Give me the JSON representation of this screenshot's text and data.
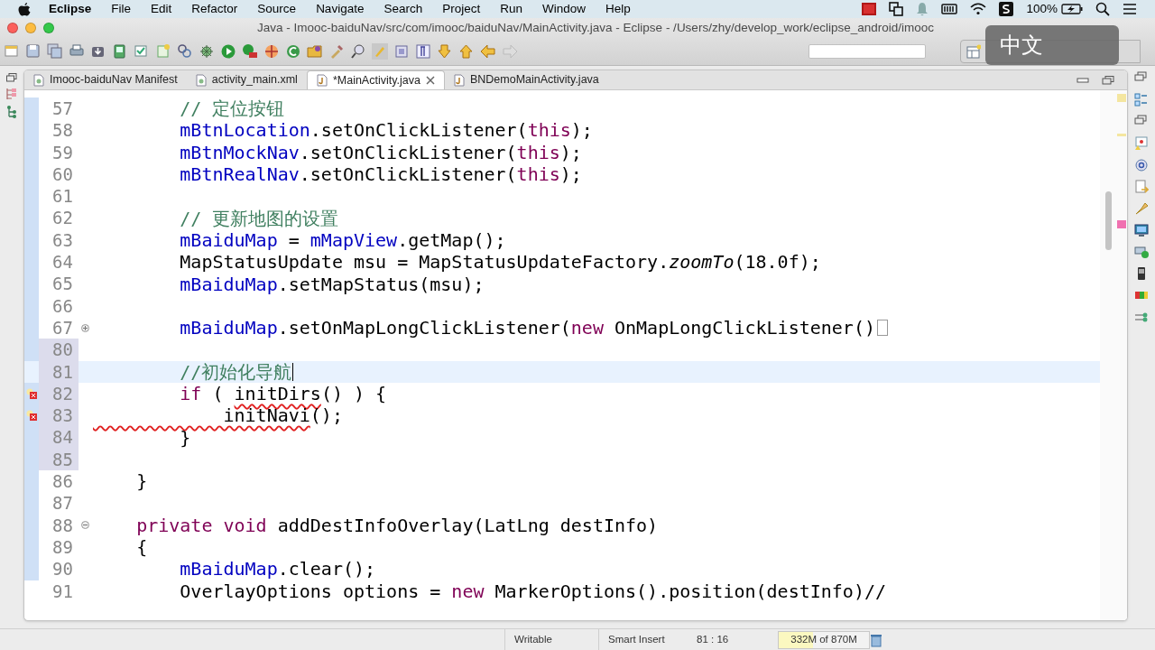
{
  "menu_bar": {
    "app": "Eclipse",
    "items": [
      "File",
      "Edit",
      "Refactor",
      "Source",
      "Navigate",
      "Search",
      "Project",
      "Run",
      "Window",
      "Help"
    ],
    "battery": "100%"
  },
  "window": {
    "title": "Java - Imooc-baiduNav/src/com/imooc/baiduNav/MainActivity.java - Eclipse - /Users/zhy/develop_work/eclipse_android/imooc"
  },
  "input_method_hud": "中文",
  "tabs": [
    {
      "label": "Imooc-baiduNav Manifest",
      "selected": false
    },
    {
      "label": "activity_main.xml",
      "selected": false
    },
    {
      "label": "*MainActivity.java",
      "selected": true
    },
    {
      "label": "BNDemoMainActivity.java",
      "selected": false
    }
  ],
  "editor": {
    "lines": [
      {
        "number": "57",
        "tokens": [
          {
            "kind": "comment",
            "text": "        // 定位按钮"
          }
        ]
      },
      {
        "number": "58",
        "tokens": [
          {
            "kind": "field",
            "text": "        mBtnLocation"
          },
          {
            "kind": "plain",
            "text": ".setOnClickListener("
          },
          {
            "kind": "keyword",
            "text": "this"
          },
          {
            "kind": "plain",
            "text": ");"
          }
        ]
      },
      {
        "number": "59",
        "tokens": [
          {
            "kind": "field",
            "text": "        mBtnMockNav"
          },
          {
            "kind": "plain",
            "text": ".setOnClickListener("
          },
          {
            "kind": "keyword",
            "text": "this"
          },
          {
            "kind": "plain",
            "text": ");"
          }
        ]
      },
      {
        "number": "60",
        "tokens": [
          {
            "kind": "field",
            "text": "        mBtnRealNav"
          },
          {
            "kind": "plain",
            "text": ".setOnClickListener("
          },
          {
            "kind": "keyword",
            "text": "this"
          },
          {
            "kind": "plain",
            "text": ");"
          }
        ]
      },
      {
        "number": "61"
      },
      {
        "number": "62",
        "tokens": [
          {
            "kind": "comment",
            "text": "        // 更新地图的设置"
          }
        ]
      },
      {
        "number": "63",
        "tokens": [
          {
            "kind": "field",
            "text": "        mBaiduMap"
          },
          {
            "kind": "plain",
            "text": " = "
          },
          {
            "kind": "field",
            "text": "mMapView"
          },
          {
            "kind": "plain",
            "text": ".getMap();"
          }
        ]
      },
      {
        "number": "64",
        "tokens": [
          {
            "kind": "plain",
            "text": "        MapStatusUpdate msu = MapStatusUpdateFactory."
          },
          {
            "kind": "static",
            "text": "zoomTo"
          },
          {
            "kind": "plain",
            "text": "(18.0f);"
          }
        ]
      },
      {
        "number": "65",
        "tokens": [
          {
            "kind": "field",
            "text": "        mBaiduMap"
          },
          {
            "kind": "plain",
            "text": ".setMapStatus(msu);"
          }
        ]
      },
      {
        "number": "66"
      },
      {
        "number": "67",
        "fold_collapsed": true,
        "folded": true,
        "tokens": [
          {
            "kind": "field",
            "text": "        mBaiduMap"
          },
          {
            "kind": "plain",
            "text": ".setOnMapLongClickListener("
          },
          {
            "kind": "keyword",
            "text": "new"
          },
          {
            "kind": "plain",
            "text": " OnMapLongClickListener()"
          }
        ]
      },
      {
        "number": "80",
        "changed": true
      },
      {
        "number": "81",
        "changed": true,
        "current": true,
        "tokens": [
          {
            "kind": "comment",
            "text": "        //初始化导航"
          }
        ]
      },
      {
        "number": "82",
        "changed": true,
        "error": true,
        "tokens": [
          {
            "kind": "keyword",
            "text": "        if"
          },
          {
            "kind": "plain",
            "text": " ( "
          },
          {
            "kind": "error",
            "text": "initDirs"
          },
          {
            "kind": "plain",
            "text": "() ) {"
          }
        ]
      },
      {
        "number": "83",
        "changed": true,
        "error": true,
        "tokens": [
          {
            "kind": "error",
            "text": "            initNavi"
          },
          {
            "kind": "plain",
            "text": "();"
          }
        ]
      },
      {
        "number": "84",
        "changed": true,
        "tokens": [
          {
            "kind": "plain",
            "text": "        }"
          }
        ]
      },
      {
        "number": "85",
        "changed": true
      },
      {
        "number": "86",
        "tokens": [
          {
            "kind": "plain",
            "text": "    }"
          }
        ]
      },
      {
        "number": "87"
      },
      {
        "number": "88",
        "fold_collapsed": false,
        "tokens": [
          {
            "kind": "keyword",
            "text": "    private void"
          },
          {
            "kind": "plain",
            "text": " addDestInfoOverlay(LatLng destInfo)"
          }
        ]
      },
      {
        "number": "89",
        "tokens": [
          {
            "kind": "plain",
            "text": "    {"
          }
        ]
      },
      {
        "number": "90",
        "tokens": [
          {
            "kind": "field",
            "text": "        mBaiduMap"
          },
          {
            "kind": "plain",
            "text": ".clear();"
          }
        ]
      },
      {
        "number": "91",
        "tokens": [
          {
            "kind": "plain",
            "text": "        OverlayOptions options = "
          },
          {
            "kind": "keyword",
            "text": "new"
          },
          {
            "kind": "plain",
            "text": " MarkerOptions().position(destInfo)//"
          }
        ]
      }
    ]
  },
  "status_bar": {
    "mode": "Writable",
    "insert": "Smart Insert",
    "position": "81 : 16",
    "memory": {
      "text": "332M of 870M",
      "level": 0.38
    }
  }
}
